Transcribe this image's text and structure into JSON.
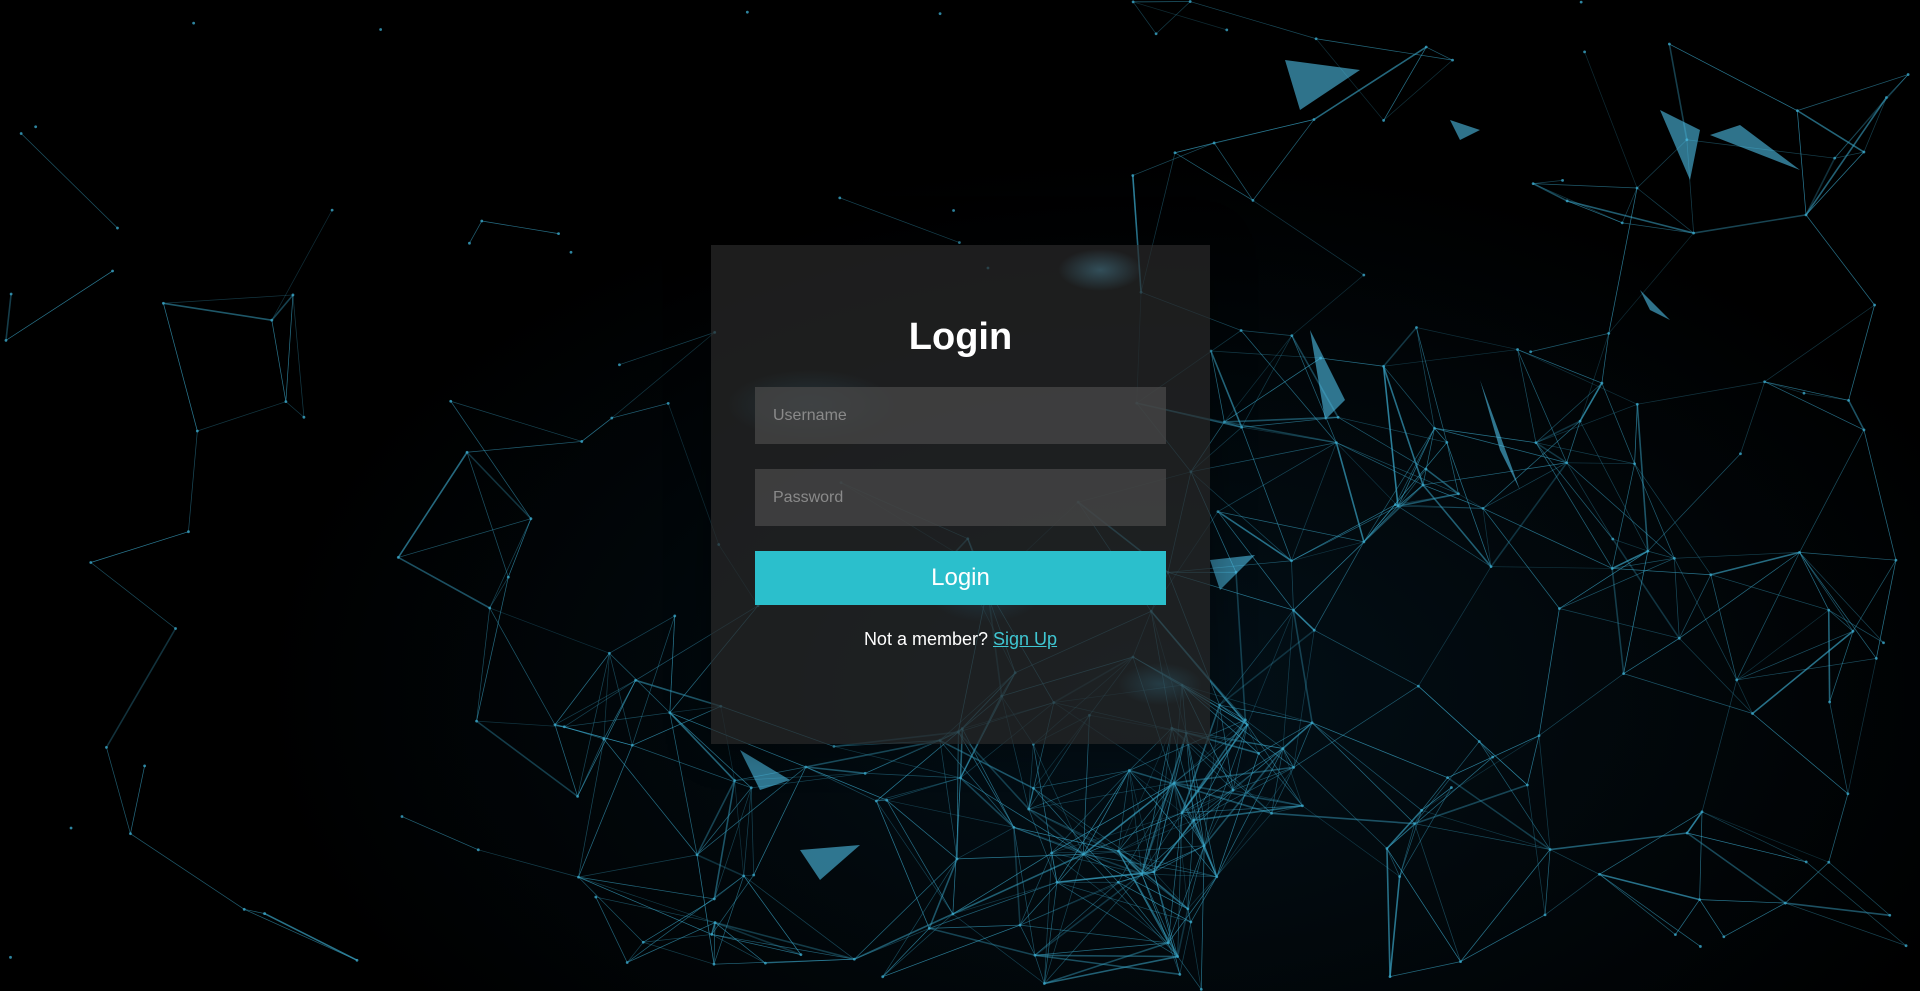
{
  "login": {
    "title": "Login",
    "username_placeholder": "Username",
    "username_value": "",
    "password_placeholder": "Password",
    "password_value": "",
    "submit_label": "Login",
    "signup_prompt": "Not a member?",
    "signup_link": "Sign Up"
  },
  "colors": {
    "accent": "#2bbfcc",
    "link": "#3fc6d2",
    "network_lines": "#3aa6c8",
    "background": "#000000"
  }
}
